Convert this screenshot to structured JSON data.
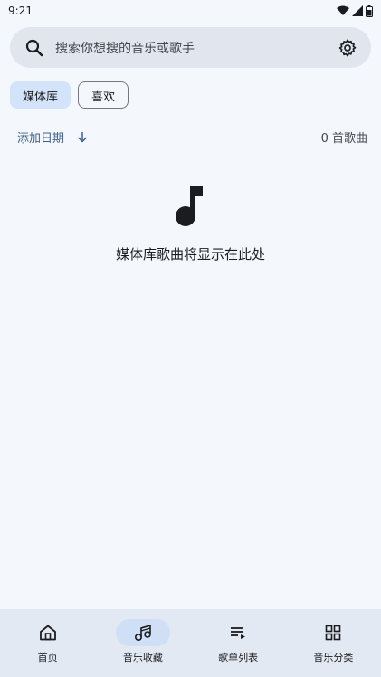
{
  "status": {
    "time": "9:21"
  },
  "search": {
    "placeholder": "搜索你想搜的音乐或歌手"
  },
  "chips": [
    {
      "label": "媒体库",
      "selected": true
    },
    {
      "label": "喜欢",
      "selected": false
    }
  ],
  "sort": {
    "label": "添加日期",
    "count": "0 首歌曲"
  },
  "empty": {
    "message": "媒体库歌曲将显示在此处"
  },
  "nav": [
    {
      "label": "首页",
      "icon": "home-icon",
      "active": false
    },
    {
      "label": "音乐收藏",
      "icon": "music-library-icon",
      "active": true
    },
    {
      "label": "歌单列表",
      "icon": "playlist-icon",
      "active": false
    },
    {
      "label": "音乐分类",
      "icon": "grid-icon",
      "active": false
    }
  ],
  "colors": {
    "accent": "#3b5f8e",
    "chip_selected": "#d3e3fa",
    "nav_active": "#cfdff6",
    "background": "#f4f8fd"
  }
}
